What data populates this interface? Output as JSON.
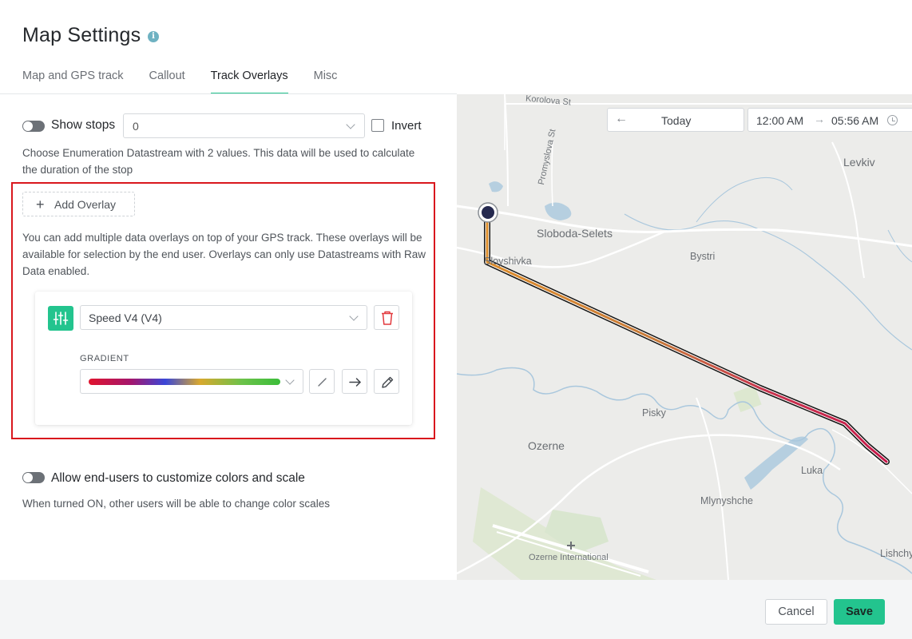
{
  "header": {
    "title": "Map Settings",
    "info_icon": "info-icon",
    "tabs": [
      {
        "label": "Map and GPS track",
        "active": false
      },
      {
        "label": "Callout",
        "active": false
      },
      {
        "label": "Track Overlays",
        "active": true
      },
      {
        "label": "Misc",
        "active": false
      }
    ]
  },
  "stops": {
    "enabled": false,
    "label": "Show stops",
    "select_value": "0",
    "invert_label": "Invert",
    "invert_checked": false,
    "help": "Choose Enumeration Datastream with 2 values. This data will be used to calculate the duration of the stop"
  },
  "overlays": {
    "add_label": "Add Overlay",
    "help": "You can add multiple data overlays on top of your GPS track. These overlays will be available for selection by the end user. Overlays can only use Datastreams with Raw Data enabled.",
    "items": [
      {
        "datastream": "Speed V4 (V4)",
        "gradient_label": "GRADIENT",
        "gradient_colors": [
          "#e0142e",
          "#a4166d",
          "#3a47d8",
          "#d9a82e",
          "#6cc24a",
          "#3bbd3a"
        ]
      }
    ]
  },
  "customize": {
    "enabled": false,
    "label": "Allow end-users to customize colors and scale",
    "help": "When turned ON, other users will be able to change color scales"
  },
  "map": {
    "date_label": "Today",
    "time_from": "12:00 AM",
    "time_sep": "→",
    "time_to": "05:56 AM",
    "labels": {
      "korolova": "Korolova St",
      "promyslova": "Promyslova St",
      "levkiv": "Levkiv",
      "sloboda": "Sloboda-Selets",
      "bystri": "Bystri",
      "shivka": "Sloyshivka",
      "pisky": "Pisky",
      "ozerne": "Ozerne",
      "luka": "Luka",
      "mlynyshche": "Mlynyshche",
      "airport": "Ozerne International",
      "lishchyn": "Lishchyn"
    },
    "track_colors": {
      "outline": "#1a1a1a",
      "start": "#e0902a",
      "end": "#c8184a",
      "marker": "#25294f"
    }
  },
  "footer": {
    "cancel_label": "Cancel",
    "save_label": "Save"
  }
}
